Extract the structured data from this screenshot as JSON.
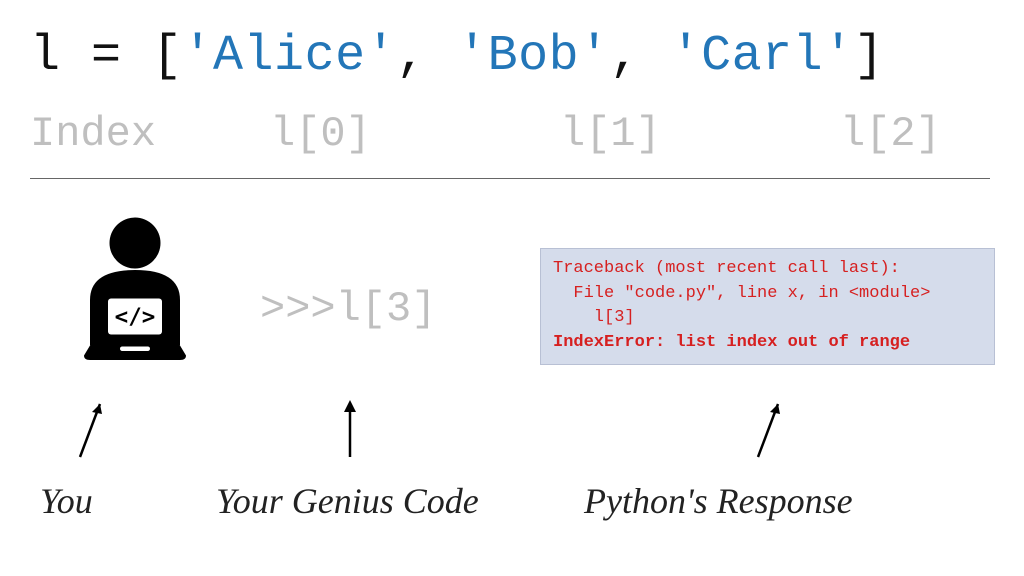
{
  "code_line": {
    "var": "l",
    "eq": " = ",
    "open": "[",
    "s1": "'Alice'",
    "c1": ", ",
    "s2": "'Bob'",
    "c2": ", ",
    "s3": "'Carl'",
    "close": "]"
  },
  "index_row": {
    "label": "Index",
    "i0": "l[0]",
    "i1": "l[1]",
    "i2": "l[2]"
  },
  "genius_code": ">>>l[3]",
  "traceback": {
    "line1": "Traceback (most recent call last):",
    "line2": "  File \"code.py\", line x, in <module>",
    "line3": "    l[3]",
    "line4": "IndexError: list index out of range"
  },
  "captions": {
    "you": "You",
    "genius": "Your Genius Code",
    "response": "Python's Response"
  },
  "icons": {
    "coder": "coder-with-laptop-icon"
  }
}
